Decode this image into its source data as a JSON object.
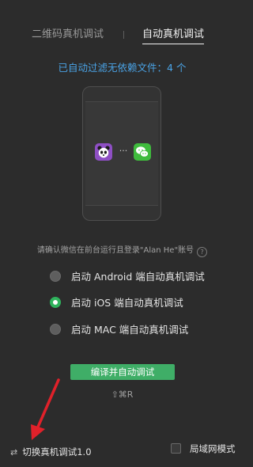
{
  "tabs": [
    {
      "label": "二维码真机调试",
      "active": false
    },
    {
      "label": "自动真机调试",
      "active": true
    }
  ],
  "filter_info": "已自动过滤无依赖文件：4 个",
  "preview": {
    "left_icon": "panda-app-icon",
    "connector": "···",
    "right_icon": "wechat-icon"
  },
  "confirm_text": "请确认微信在前台运行且登录\"Alan He\"账号",
  "help_icon_glyph": "?",
  "options": [
    {
      "label": "启动 Android 端自动真机调试",
      "checked": false
    },
    {
      "label": "启动 iOS 端自动真机调试",
      "checked": true
    },
    {
      "label": "启动 MAC 端自动真机调试",
      "checked": false
    }
  ],
  "compile_button": "编译并自动调试",
  "shortcut": "⇧⌘R",
  "footer": {
    "switch_icon": "⇄",
    "switch_label": "切换真机调试1.0",
    "lan_label": "局域网模式",
    "lan_checked": false
  },
  "colors": {
    "background": "#2c2c2c",
    "accent_green": "#3fae67",
    "info_blue": "#4aa3e6",
    "arrow_red": "#e0212a"
  }
}
